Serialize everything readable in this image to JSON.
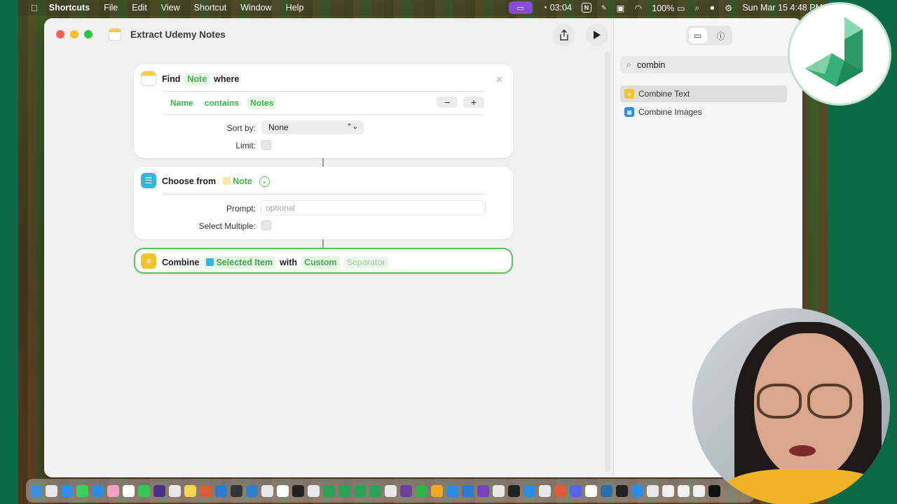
{
  "menubar": {
    "apple_icon": "apple-logo",
    "app_name": "Shortcuts",
    "items": [
      "File",
      "Edit",
      "View",
      "Shortcut",
      "Window",
      "Help"
    ],
    "timer": "03:04",
    "battery": "100%",
    "datetime": "Sun Mar 15  4:48 PM"
  },
  "window": {
    "title": "Extract Udemy Notes",
    "share_icon": "share-icon",
    "run_icon": "play-icon"
  },
  "actions": {
    "find": {
      "verb": "Find",
      "type": "Note",
      "where": "where",
      "filter": {
        "field": "Name",
        "op": "contains",
        "value": "Notes"
      },
      "minus": "−",
      "plus": "+",
      "sort_label": "Sort by:",
      "sort_value": "None",
      "limit_label": "Limit:"
    },
    "choose": {
      "verb": "Choose from",
      "source": "Note",
      "prompt_label": "Prompt:",
      "prompt_placeholder": "optional",
      "multiple_label": "Select Multiple:"
    },
    "combine": {
      "verb": "Combine",
      "input": "Selected Item",
      "with": "with",
      "mode": "Custom",
      "separator_placeholder": "Separator"
    }
  },
  "sidebar": {
    "search_value": "combin",
    "results": [
      {
        "label": "Combine Text",
        "icon": "text-icon",
        "color": "#f5c22f",
        "selected": true
      },
      {
        "label": "Combine Images",
        "icon": "images-icon",
        "color": "#2f8fe8",
        "selected": false
      }
    ]
  },
  "colors": {
    "accent_green": "#44b549",
    "selected_border": "#5fc063"
  }
}
